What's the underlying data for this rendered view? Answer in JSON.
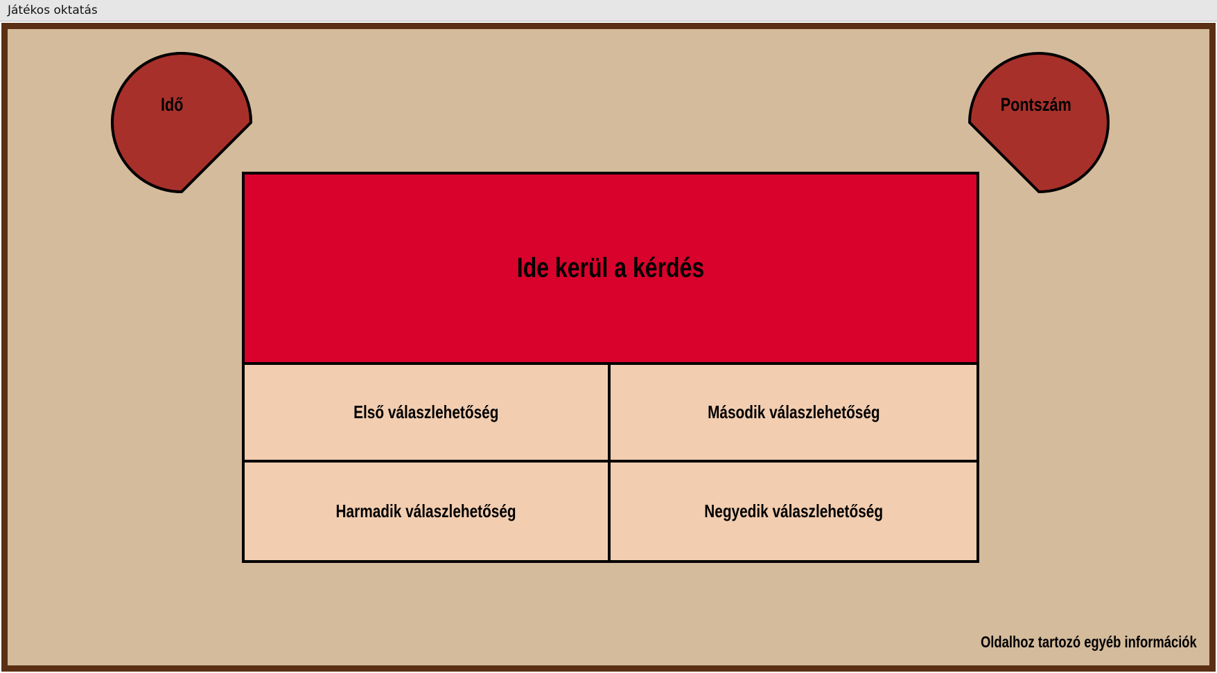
{
  "window": {
    "title": "Játékos oktatás"
  },
  "gauges": {
    "time_label": "Idő",
    "score_label": "Pontszám"
  },
  "quiz": {
    "question": "Ide kerül a kérdés",
    "answers": [
      "Első válaszlehetőség",
      "Második válaszlehetőség",
      "Harmadik válaszlehetőség",
      "Negyedik válaszlehetőség"
    ]
  },
  "footer": {
    "info": "Oldalhoz tartozó egyéb információk"
  },
  "colors": {
    "background": "#d4bb9c",
    "frame": "#5a2f14",
    "gauge_fill": "#a8302b",
    "question_fill": "#d8022c",
    "answer_fill": "#f2cdb0"
  }
}
